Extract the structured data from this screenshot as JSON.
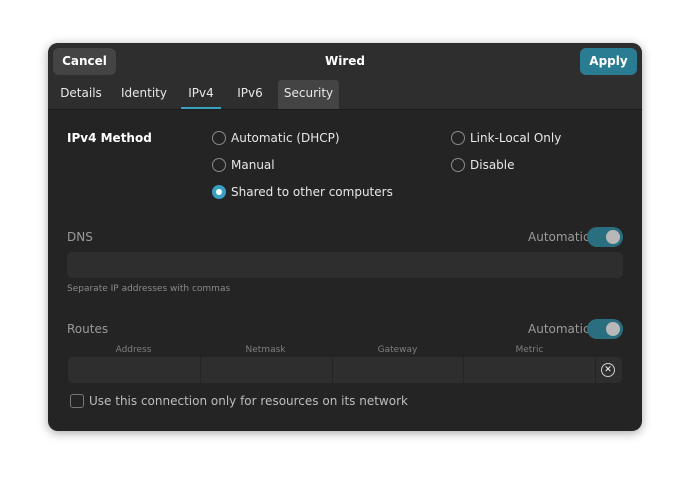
{
  "header": {
    "title": "Wired",
    "cancel_label": "Cancel",
    "apply_label": "Apply"
  },
  "tabs": [
    {
      "label": "Details"
    },
    {
      "label": "Identity"
    },
    {
      "label": "IPv4"
    },
    {
      "label": "IPv6"
    },
    {
      "label": "Security"
    }
  ],
  "ipv4": {
    "method_label": "IPv4 Method",
    "options": [
      {
        "label": "Automatic (DHCP)",
        "selected": false
      },
      {
        "label": "Link-Local Only",
        "selected": false
      },
      {
        "label": "Manual",
        "selected": false
      },
      {
        "label": "Disable",
        "selected": false
      },
      {
        "label": "Shared to other computers",
        "selected": true
      }
    ]
  },
  "dns": {
    "title": "DNS",
    "automatic_label": "Automatic",
    "automatic_on": true,
    "value": "",
    "hint": "Separate IP addresses with commas"
  },
  "routes": {
    "title": "Routes",
    "automatic_label": "Automatic",
    "automatic_on": true,
    "columns": [
      "Address",
      "Netmask",
      "Gateway",
      "Metric"
    ],
    "checkbox_label": "Use this connection only for resources on its network",
    "checkbox_checked": false
  },
  "colors": {
    "accent": "#3aa0c0",
    "apply": "#2a7c93",
    "toggle_on": "#2a6f7f",
    "background": "#242424"
  },
  "icons": {
    "remove": "circle-x-icon"
  }
}
